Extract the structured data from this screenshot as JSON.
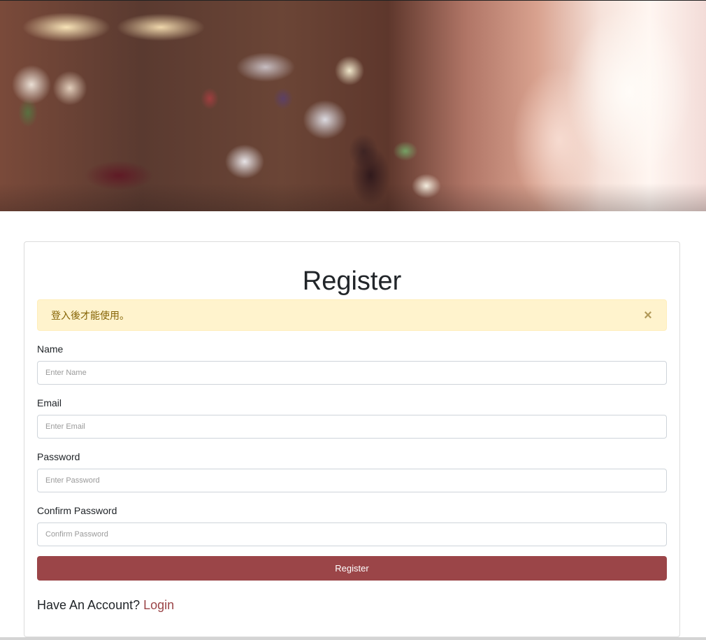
{
  "hero": {
    "alt": "blurred cafe background"
  },
  "form": {
    "title": "Register",
    "alert": {
      "message": "登入後才能使用。",
      "close_symbol": "×"
    },
    "fields": [
      {
        "label": "Name",
        "placeholder": "Enter Name",
        "value": ""
      },
      {
        "label": "Email",
        "placeholder": "Enter Email",
        "value": ""
      },
      {
        "label": "Password",
        "placeholder": "Enter Password",
        "value": ""
      },
      {
        "label": "Confirm Password",
        "placeholder": "Confirm Password",
        "value": ""
      }
    ],
    "submit_label": "Register",
    "account_prompt": "Have An Account?",
    "login_link": "Login"
  },
  "colors": {
    "primary": "#9b4548",
    "alert_bg": "#fff3cd",
    "alert_text": "#856404"
  }
}
